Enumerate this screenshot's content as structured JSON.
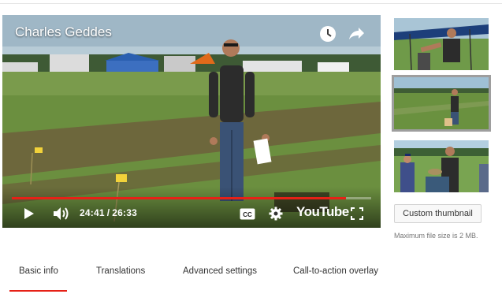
{
  "player": {
    "title": "Charles Geddes",
    "current_time": "24:41",
    "separator": "/",
    "duration": "26:33",
    "progress_fraction": 0.93,
    "brand": "YouTube",
    "icons": [
      "watch-later-icon",
      "share-icon",
      "play-icon",
      "volume-icon",
      "captions-icon",
      "settings-icon",
      "fullscreen-icon"
    ]
  },
  "thumbnails": {
    "items": [
      {
        "label": "thumbnail-1",
        "selected": false
      },
      {
        "label": "thumbnail-2",
        "selected": true
      },
      {
        "label": "thumbnail-3",
        "selected": false
      }
    ],
    "custom_button": "Custom thumbnail",
    "size_note": "Maximum file size is 2 MB."
  },
  "tabs": [
    {
      "label": "Basic info",
      "active": true
    },
    {
      "label": "Translations",
      "active": false
    },
    {
      "label": "Advanced settings",
      "active": false
    },
    {
      "label": "Call-to-action overlay",
      "active": false
    }
  ],
  "colors": {
    "accent": "#e62117",
    "selected_outline": "#9e9e9e"
  }
}
